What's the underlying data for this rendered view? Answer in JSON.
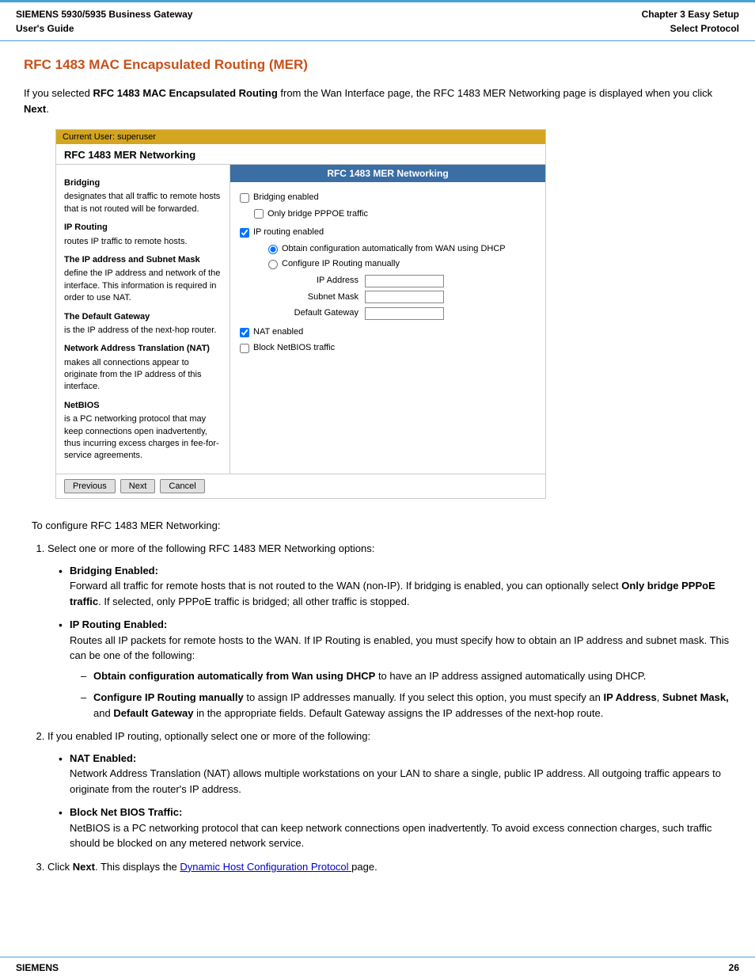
{
  "header": {
    "left_line1": "SIEMENS 5930/5935 Business Gateway",
    "left_line2": "User's Guide",
    "right_line1": "Chapter 3  Easy Setup",
    "right_line2": "Select Protocol"
  },
  "page_title": "RFC 1483 MAC Encapsulated Routing (MER)",
  "intro": {
    "text1": "If you selected ",
    "bold1": "RFC 1483 MAC Encapsulated Routing",
    "text2": " from the Wan Interface page, the RFC 1483 MER Networking page is displayed when you click ",
    "bold2": "Next",
    "text3": "."
  },
  "screenshot": {
    "titlebar": "Current User: superuser",
    "main_header": "RFC 1483 MER Networking",
    "right_panel_title": "RFC 1483 MER Networking",
    "left_panel": {
      "term1": "Bridging",
      "desc1": "designates that all traffic to remote hosts that is not routed will be forwarded.",
      "term2": "IP Routing",
      "desc2": "routes IP traffic to remote hosts.",
      "term3": "The IP address and Subnet Mask",
      "desc3": "define the IP address and network of the interface. This information is required in order to use NAT.",
      "term4": "The Default Gateway",
      "desc4": "is the IP address of the next-hop router.",
      "term5": "Network Address Translation (NAT)",
      "desc5": "makes all connections appear to originate from the IP address of this interface.",
      "term6": "NetBIOS",
      "desc6": "is a PC networking protocol that may keep connections open inadvertently, thus incurring excess charges in fee-for-service agreements."
    },
    "right_panel": {
      "bridging_enabled": "Bridging enabled",
      "only_bridge": "Only bridge PPPOE traffic",
      "ip_routing": "IP routing enabled",
      "obtain_auto": "Obtain configuration automatically from WAN using DHCP",
      "configure_manual": "Configure IP Routing manually",
      "ip_address_label": "IP Address",
      "subnet_mask_label": "Subnet Mask",
      "default_gateway_label": "Default Gateway",
      "nat_enabled": "NAT enabled",
      "block_netbios": "Block NetBIOS traffic"
    },
    "buttons": {
      "previous": "Previous",
      "next": "Next",
      "cancel": "Cancel"
    }
  },
  "instructions": {
    "intro": "To configure RFC 1483 MER Networking:",
    "step1": "Select one or more of the following RFC 1483 MER Networking options:",
    "bullet1_title": "Bridging Enabled:",
    "bullet1_text": "Forward all traffic for remote hosts that is not routed to the WAN (non-IP). If bridging is enabled, you can optionally select ",
    "bullet1_bold": "Only bridge PPPoE traffic",
    "bullet1_text2": ". If selected, only PPPoE traffic is bridged; all other traffic is stopped.",
    "bullet2_title": "IP Routing Enabled:",
    "bullet2_text": "Routes all IP packets for remote hosts to the WAN. If IP Routing is enabled, you must specify how to obtain an IP address and subnet mask. This can be one of the following:",
    "sub1_bold": "Obtain configuration automatically from Wan using DHCP",
    "sub1_text": " to have an IP address assigned automatically using DHCP.",
    "sub2_bold": "Configure IP Routing manually",
    "sub2_text": " to assign IP addresses manually. If you select this option, you must specify an ",
    "sub2_bold2": "IP Address",
    "sub2_text2": ", ",
    "sub2_bold3": "Subnet Mask,",
    "sub2_text3": " and ",
    "sub2_bold4": "Default Gateway",
    "sub2_text4": " in the appropriate fields. Default Gateway assigns the IP addresses of the next-hop route.",
    "step2": "If you enabled IP routing, optionally select one or more of the following:",
    "bullet3_title": "NAT Enabled:",
    "bullet3_text": "Network Address Translation (NAT) allows multiple workstations on your LAN to share a single, public IP address. All outgoing traffic appears to originate from the router's IP address.",
    "bullet4_title": "Block Net BIOS Traffic:",
    "bullet4_text": "NetBIOS is a PC networking protocol that can keep network connections open inadvertently. To avoid excess connection charges, such traffic should be blocked on any metered network service.",
    "step3_text1": "Click ",
    "step3_bold": "Next",
    "step3_text2": ". This displays the ",
    "step3_link": "Dynamic Host Configuration Protocol ",
    "step3_text3": "page."
  },
  "footer": {
    "left": "SIEMENS",
    "right": "26"
  }
}
